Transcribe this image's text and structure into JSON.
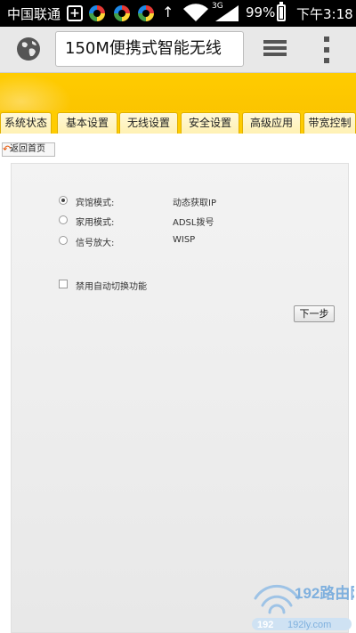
{
  "status_bar": {
    "carrier": "中国联通",
    "network_type": "3G",
    "battery_percent": "99%",
    "time": "下午3:18",
    "icons": [
      "plus-icon",
      "app-icon",
      "app-icon",
      "app-icon",
      "up-arrow-icon",
      "wifi-icon",
      "signal-icon",
      "battery-icon"
    ]
  },
  "browser": {
    "page_title": "150M便携式智能无线",
    "icons": [
      "globe-icon",
      "tabs-icon",
      "overflow-menu-icon"
    ]
  },
  "nav": {
    "tabs": [
      "系统状态",
      "基本设置",
      "无线设置",
      "安全设置",
      "高级应用",
      "带宽控制"
    ]
  },
  "page": {
    "home_link": "返回首页",
    "options": [
      {
        "label": "宾馆模式:",
        "value": "动态获取IP",
        "checked": true
      },
      {
        "label": "家用模式:",
        "value": "ADSL拨号",
        "checked": false
      },
      {
        "label": "信号放大:",
        "value": "WISP",
        "checked": false
      }
    ],
    "disable_auto_switch": "禁用自动切换功能",
    "next_button": "下一步"
  },
  "colors": {
    "banner": "#ffcc00",
    "status_bar": "#000000",
    "toolbar": "#e8e8e8"
  }
}
